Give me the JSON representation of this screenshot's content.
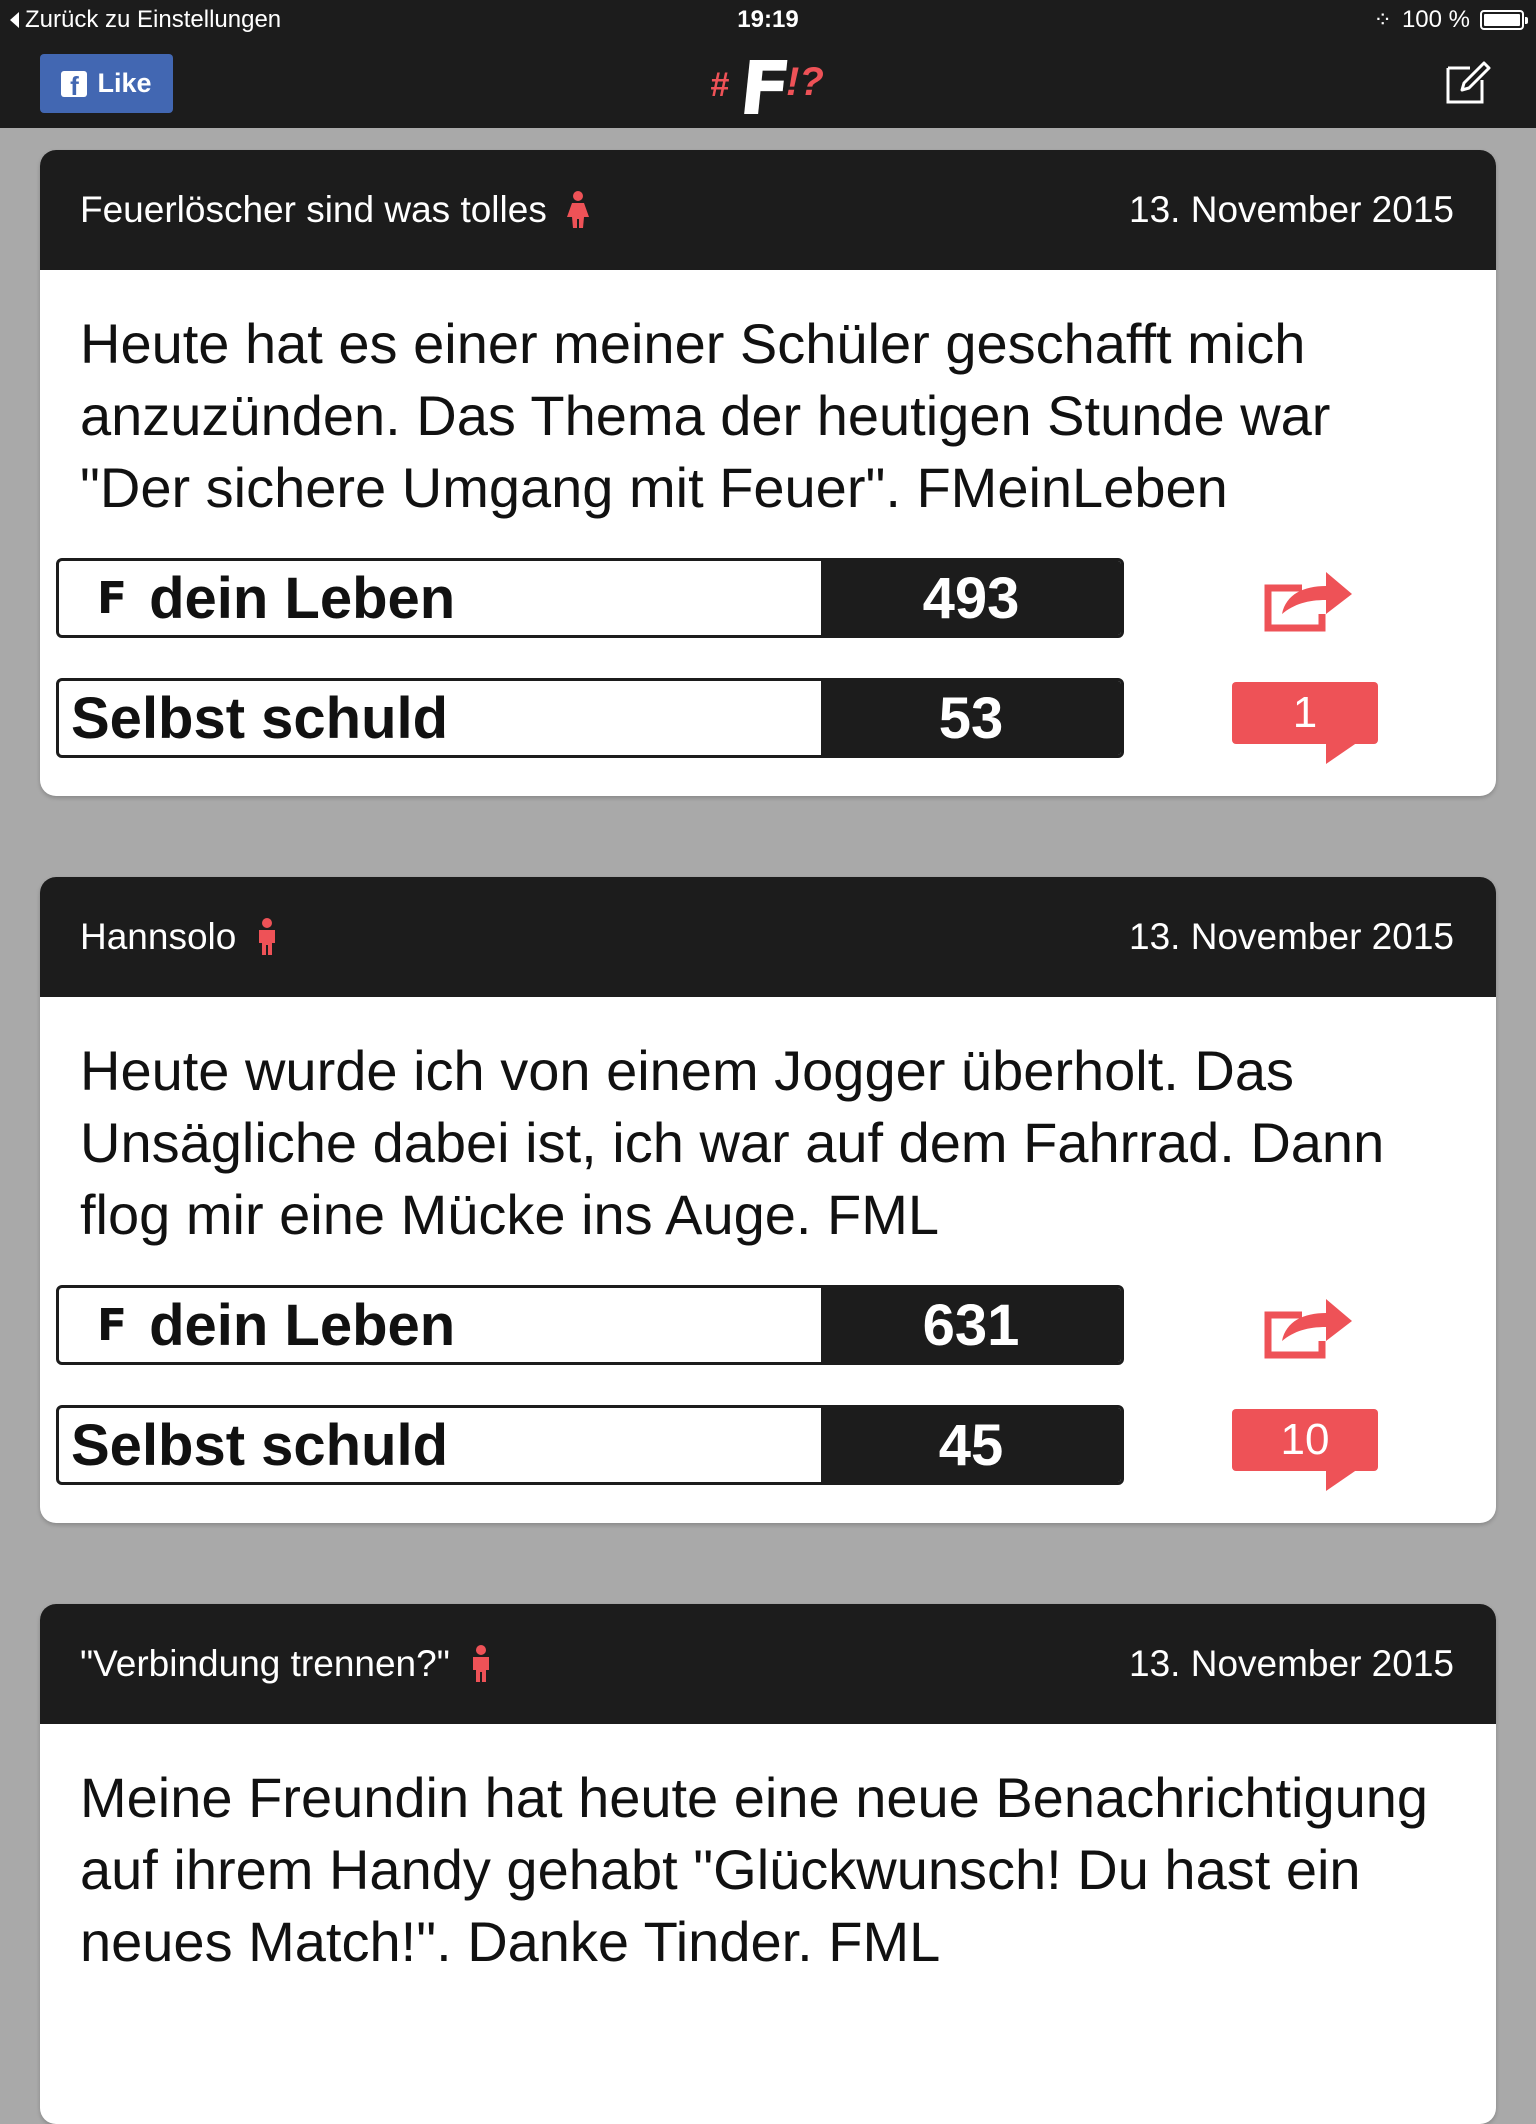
{
  "status_bar": {
    "back_label": "Zurück zu Einstellungen",
    "time": "19:19",
    "battery": "100 %"
  },
  "nav": {
    "like_label": "Like",
    "logo_hash": "#",
    "logo_letter": "F",
    "logo_marks": "!?"
  },
  "colors": {
    "accent": "#ee5257",
    "dark": "#1c1c1c",
    "facebook": "#4267b2",
    "background": "#a9a9a9"
  },
  "posts": [
    {
      "author": "Feuerlöscher sind was tolles",
      "gender_icon": "female-icon",
      "date": "13. November 2015",
      "text": "Heute hat es einer meiner Schüler geschafft mich anzuzünden. Das Thema der heutigen Stunde war \"Der sichere Umgang mit Feuer\". FMeinLeben",
      "vote1_mark": "F",
      "vote1_label": "dein Leben",
      "vote1_count": "493",
      "vote2_label": "Selbst schuld",
      "vote2_count": "53",
      "comments": "1"
    },
    {
      "author": "Hannsolo",
      "gender_icon": "male-icon",
      "date": "13. November 2015",
      "text": "Heute wurde ich von einem Jogger überholt. Das Unsägliche dabei ist, ich war auf dem Fahrrad. Dann flog mir eine Mücke ins Auge. FML",
      "vote1_mark": "F",
      "vote1_label": "dein Leben",
      "vote1_count": "631",
      "vote2_label": "Selbst schuld",
      "vote2_count": "45",
      "comments": "10"
    },
    {
      "author": "\"Verbindung trennen?\"",
      "gender_icon": "male-icon",
      "date": "13. November 2015",
      "text": "Meine Freundin hat heute eine neue Benachrichtigung auf ihrem Handy gehabt \"Glückwunsch! Du hast ein neues Match!\". Danke Tinder. FML"
    }
  ]
}
